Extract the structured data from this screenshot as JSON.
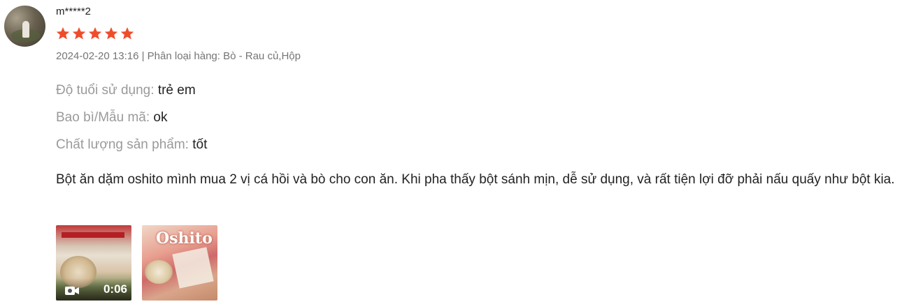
{
  "review": {
    "username": "m*****2",
    "rating": 5,
    "star_color": "#ee4d2d",
    "meta": "2024-02-20 13:16 | Phân loại hàng: Bò - Rau củ,Hộp",
    "attributes": [
      {
        "label": "Độ tuổi sử dụng:",
        "value": "trẻ em"
      },
      {
        "label": "Bao bì/Mẫu mã:",
        "value": "ok"
      },
      {
        "label": "Chất lượng sản phẩm:",
        "value": "tốt"
      }
    ],
    "comment": "Bột ăn dặm oshito mình mua 2 vị cá hồi và bò cho con ăn. Khi pha thấy bột sánh mịn, dễ sử dụng, và rất tiện lợi đỡ phải nấu quấy như bột kia.",
    "media": [
      {
        "type": "video",
        "duration": "0:06",
        "icon": "video-camera-icon"
      },
      {
        "type": "image",
        "brand_text": "Oshito"
      }
    ]
  }
}
